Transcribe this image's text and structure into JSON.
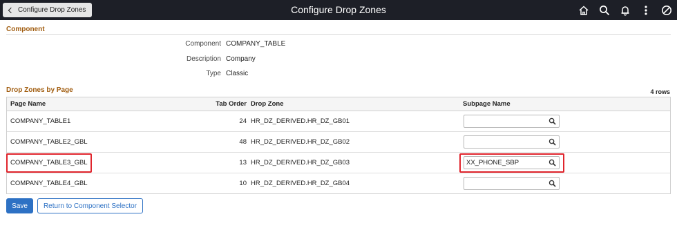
{
  "header": {
    "back_label": "Configure Drop Zones",
    "title": "Configure Drop Zones",
    "icons": [
      "home-icon",
      "search-icon",
      "bell-icon",
      "more-vertical-icon",
      "no-entry-icon"
    ]
  },
  "component_section": {
    "title": "Component",
    "fields": [
      {
        "label": "Component",
        "value": "COMPANY_TABLE"
      },
      {
        "label": "Description",
        "value": "Company"
      },
      {
        "label": "Type",
        "value": "Classic"
      }
    ]
  },
  "dropzones": {
    "title": "Drop Zones by Page",
    "row_count": "4 rows",
    "columns": {
      "page": "Page Name",
      "tab": "Tab Order",
      "zone": "Drop Zone",
      "subpage": "Subpage Name"
    },
    "rows": [
      {
        "page": "COMPANY_TABLE1",
        "tab": "24",
        "zone": "HR_DZ_DERIVED.HR_DZ_GB01",
        "subpage": ""
      },
      {
        "page": "COMPANY_TABLE2_GBL",
        "tab": "48",
        "zone": "HR_DZ_DERIVED.HR_DZ_GB02",
        "subpage": ""
      },
      {
        "page": "COMPANY_TABLE3_GBL",
        "tab": "13",
        "zone": "HR_DZ_DERIVED.HR_DZ_GB03",
        "subpage": "XX_PHONE_SBP"
      },
      {
        "page": "COMPANY_TABLE4_GBL",
        "tab": "10",
        "zone": "HR_DZ_DERIVED.HR_DZ_GB04",
        "subpage": ""
      }
    ]
  },
  "buttons": {
    "save": "Save",
    "return": "Return to Component Selector"
  },
  "colors": {
    "header_bg": "#1d1f27",
    "section_title": "#a15d10",
    "primary": "#2d71c4",
    "highlight": "#e0242c"
  }
}
